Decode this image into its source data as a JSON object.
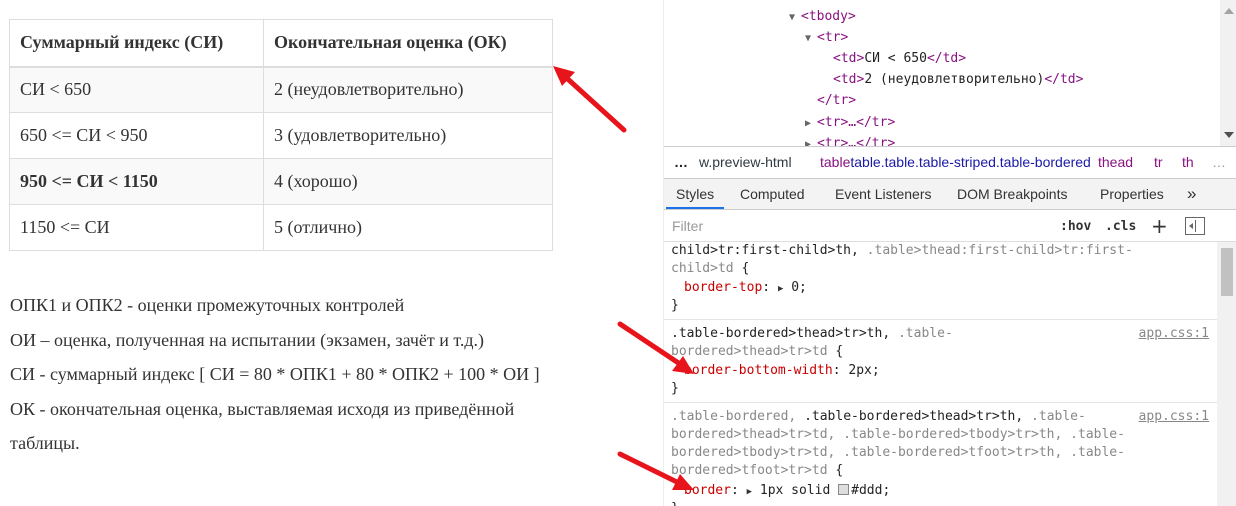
{
  "table": {
    "headers": [
      "Суммарный индекс (СИ)",
      "Окончательная оценка (ОК)"
    ],
    "rows": [
      [
        "СИ < 650",
        "2 (неудовлетворительно)"
      ],
      [
        "650 <= СИ < 950",
        "3 (удовлетворительно)"
      ],
      [
        "950 <= СИ < 1150",
        "4 (хорошо)"
      ],
      [
        "1150 <= СИ",
        "5 (отлично)"
      ]
    ]
  },
  "notes": [
    "ОПК1 и ОПК2 - оценки промежуточных контролей",
    "ОИ – оценка, полученная на испытании (экзамен, зачёт и т.д.)",
    "СИ - суммарный индекс [ СИ = 80 * ОПК1 + 80 * ОПК2 + 100 * ОИ ]",
    "ОК - окончательная оценка, выставляемая исходя из приведённой",
    "таблицы."
  ],
  "elements": {
    "tbody_open": "<tbody>",
    "tr_open": "<tr>",
    "td1": "<td>",
    "td1_text": "СИ < 650",
    "td1_close": "</td>",
    "td2": "<td>",
    "td2_text": "2 (неудовлетворительно)",
    "td2_close": "</td>",
    "tr_close": "</tr>",
    "tr_collapsed": "<tr>…</tr>",
    "tr_partial": "<tr>…</tr>"
  },
  "breadcrumbs": {
    "more": "…",
    "items": [
      "w.preview-html",
      "table.table.table-striped.table-bordered",
      "thead",
      "tr",
      "th"
    ],
    "trailing": "…"
  },
  "tabs": [
    "Styles",
    "Computed",
    "Event Listeners",
    "DOM Breakpoints",
    "Properties"
  ],
  "tabs_more": "»",
  "filter": {
    "placeholder": "Filter",
    "hov": ":hov",
    "cls": ".cls",
    "plus": "+"
  },
  "rules": [
    {
      "selector_lines": [
        "child>tr:first-child>th, .table>thead:first-child>tr:first-",
        "child>td {"
      ],
      "prop": "border-top",
      "value": "0;",
      "close": "}"
    },
    {
      "selector_lines": [
        ".table-bordered>thead>tr>th, .table-",
        "bordered>thead>tr>td {"
      ],
      "source": "app.css:1",
      "prop": "border-bottom-width",
      "value": "2px;",
      "close": "}"
    },
    {
      "selector_lines": [
        ".table-bordered, .table-bordered>thead>tr>th, .table-",
        "bordered>thead>tr>td, .table-bordered>tbody>tr>th, .table-",
        "bordered>tbody>tr>td, .table-bordered>tfoot>tr>th, .table-",
        "bordered>tfoot>tr>td {"
      ],
      "source": "app.css:1",
      "prop": "border",
      "value": "1px solid",
      "color_value": "#ddd;",
      "close": "}"
    }
  ],
  "colors": {
    "arrow": "#e8141b",
    "tag": "#881280",
    "prop": "#c80000",
    "tab_underline": "#1a73e8",
    "swatch": "#dddddd"
  },
  "icons": [
    "triangle-expanded-icon",
    "triangle-collapsed-icon",
    "scroll-up-icon",
    "scroll-down-icon",
    "toggle-sidebar-icon",
    "red-arrow-icon"
  ]
}
